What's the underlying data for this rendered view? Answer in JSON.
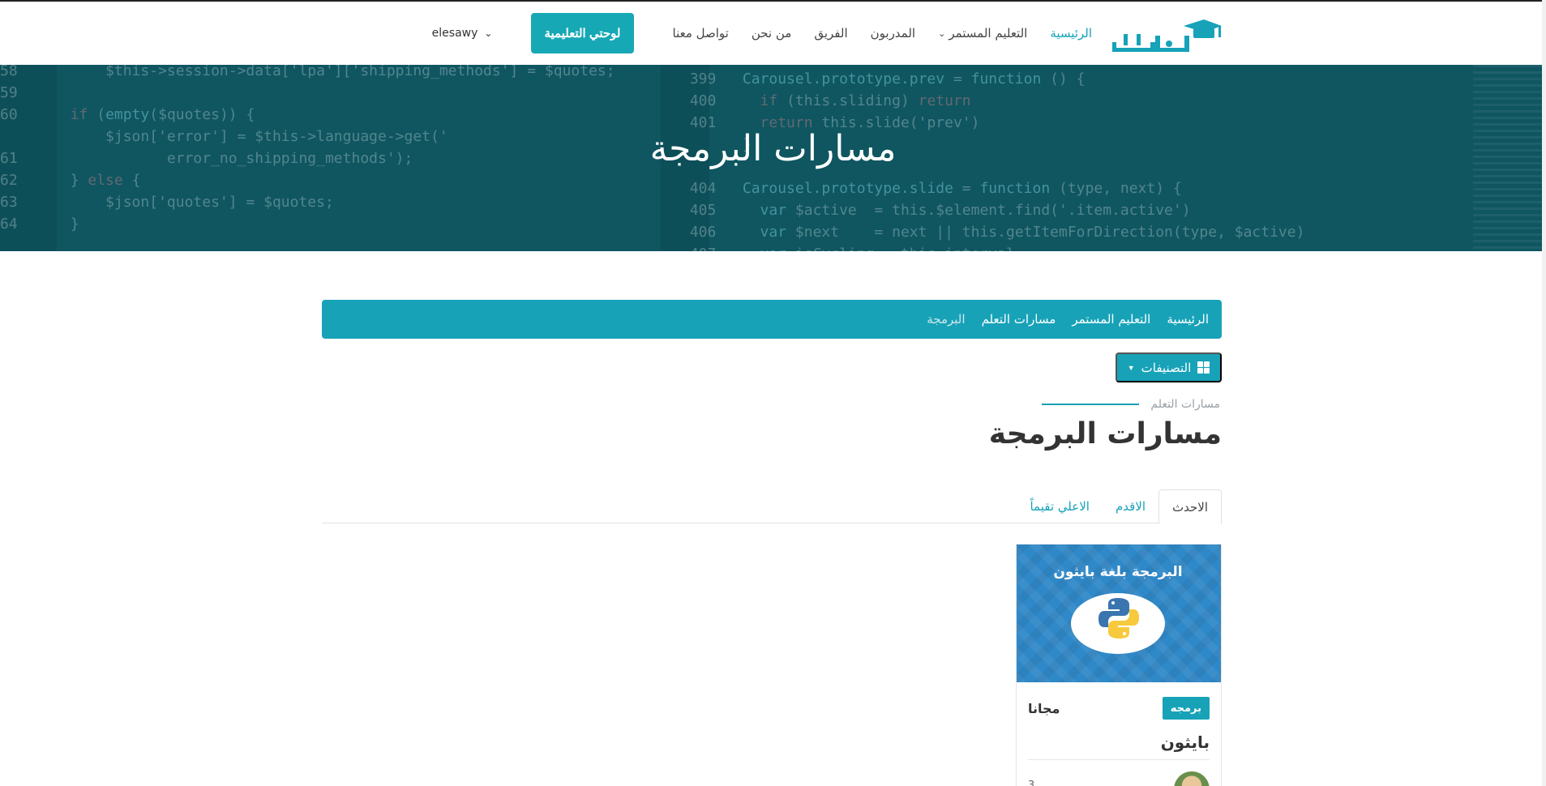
{
  "header": {
    "logo_text": "كاريري",
    "nav": [
      {
        "label": "الرئيسية",
        "active": true
      },
      {
        "label": "التعليم المستمر",
        "dropdown": true
      },
      {
        "label": "المدربون"
      },
      {
        "label": "الفريق"
      },
      {
        "label": "من نحن"
      },
      {
        "label": "تواصل معنا"
      }
    ],
    "cta_label": "لوحتي التعليمية",
    "username": "elesawy"
  },
  "hero": {
    "title": "مسارات البرمجة"
  },
  "breadcrumb": [
    "الرئيسية",
    "التعليم المستمر",
    "مسارات التعلم",
    "البرمجة"
  ],
  "categories_label": "التصنيفات",
  "section": {
    "eyebrow": "مسارات التعلم",
    "title": "مسارات البرمجة"
  },
  "tabs": [
    {
      "label": "الاحدث",
      "active": true
    },
    {
      "label": "الاقدم"
    },
    {
      "label": "الاعلي تقيماً"
    }
  ],
  "course": {
    "thumb_title": "البرمجة بلغة بايثون",
    "badge": "برمجه",
    "price": "مجانا",
    "title": "بايثون",
    "footer_text": "3"
  },
  "colors": {
    "accent": "#17a2b8",
    "hero_bg": "#0f5661"
  }
}
